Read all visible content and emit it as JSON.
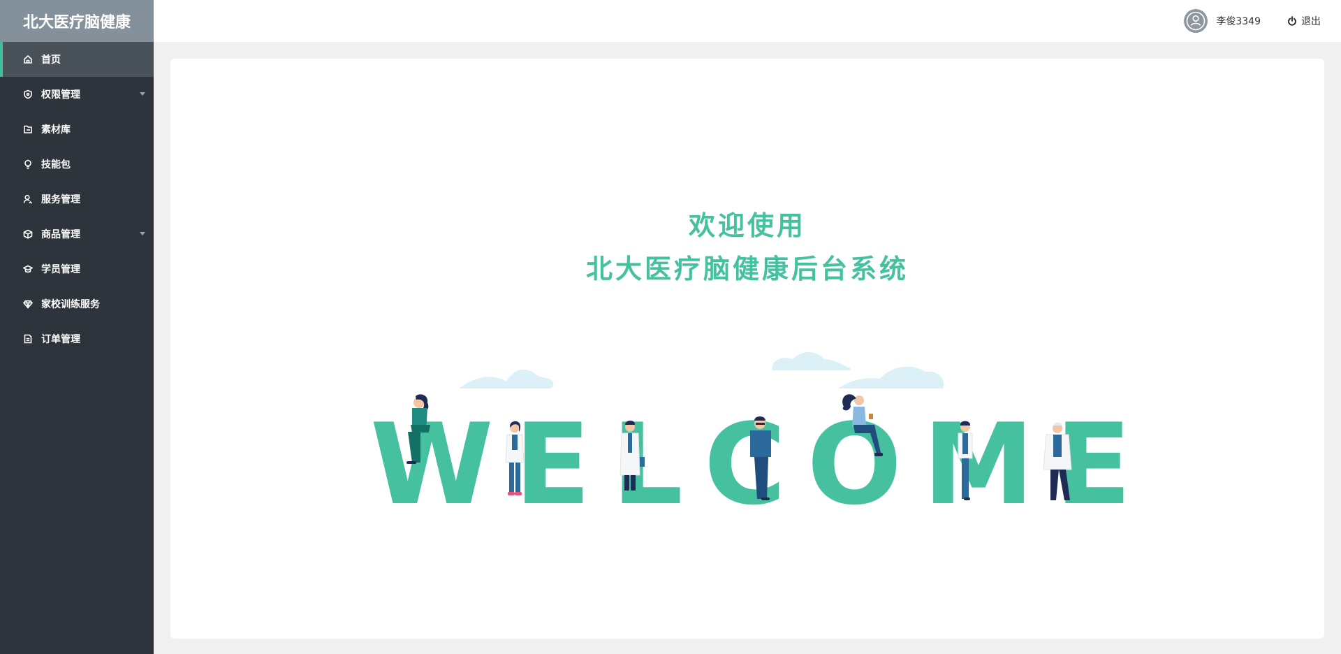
{
  "app": {
    "brand": "北大医疗脑健康"
  },
  "sidebar": {
    "items": [
      {
        "label": "首页",
        "icon": "home-icon",
        "active": true,
        "has_submenu": false
      },
      {
        "label": "权限管理",
        "icon": "shield-icon",
        "active": false,
        "has_submenu": true
      },
      {
        "label": "素材库",
        "icon": "folder-icon",
        "active": false,
        "has_submenu": false
      },
      {
        "label": "技能包",
        "icon": "bulb-icon",
        "active": false,
        "has_submenu": false
      },
      {
        "label": "服务管理",
        "icon": "user-service-icon",
        "active": false,
        "has_submenu": false
      },
      {
        "label": "商品管理",
        "icon": "box-icon",
        "active": false,
        "has_submenu": true
      },
      {
        "label": "学员管理",
        "icon": "graduation-cap-icon",
        "active": false,
        "has_submenu": false
      },
      {
        "label": "家校训练服务",
        "icon": "diamond-icon",
        "active": false,
        "has_submenu": false
      },
      {
        "label": "订单管理",
        "icon": "document-icon",
        "active": false,
        "has_submenu": false
      }
    ]
  },
  "header": {
    "username": "李俊3349",
    "avatar_icon": "user-avatar-icon",
    "logout_label": "退出",
    "logout_icon": "power-icon"
  },
  "main": {
    "welcome_line1": "欢迎使用",
    "welcome_line2": "北大医疗脑健康后台系统",
    "banner_word": "WELCOME"
  },
  "colors": {
    "accent": "#45c1a0",
    "sidebar_bg": "#2d343b",
    "brand_bg": "#84909a",
    "active_item_bg": "#495159",
    "active_marker": "#3dbf9a",
    "cloud": "#dcf0f8",
    "figure_navy": "#1f2b55",
    "figure_teal": "#1d8b80",
    "figure_blue": "#2b6a9a"
  }
}
